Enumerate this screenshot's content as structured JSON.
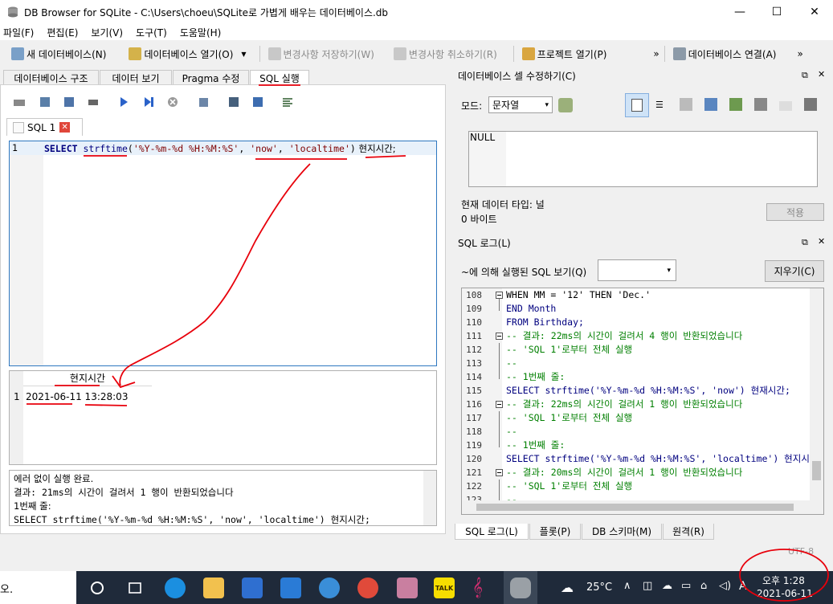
{
  "window": {
    "title": "DB Browser for SQLite - C:\\Users\\choeu\\SQLite로 가볍게 배우는 데이터베이스.db",
    "minimize": "—",
    "maximize": "☐",
    "close": "✕"
  },
  "menu": [
    "파일(F)",
    "편집(E)",
    "보기(V)",
    "도구(T)",
    "도움말(H)"
  ],
  "toolbar": {
    "new_db": "새 데이터베이스(N)",
    "open_db": "데이터베이스 열기(O)",
    "write_changes": "변경사항 저장하기(W)",
    "revert_changes": "변경사항 취소하기(R)",
    "open_project": "프로젝트 열기(P)",
    "attach_db": "데이터베이스 연결(A)",
    "overflow": "»"
  },
  "tabs": [
    "데이터베이스 구조",
    "데이터 보기",
    "Pragma 수정",
    "SQL 실행"
  ],
  "sql_tab": {
    "label": "SQL 1"
  },
  "editor": {
    "line_no": "1",
    "kw_select": "SELECT",
    "fn": "strftime",
    "p1": "(",
    "s1": "'%Y-%m-%d %H:%M:%S'",
    "c1": ", ",
    "s2": "'now'",
    "c2": ", ",
    "s3": "'localtime'",
    "p2": ")",
    "alias": " 현지시간;"
  },
  "result": {
    "header": "현지시간",
    "row_no": "1",
    "value": "2021-06-11 13:28:03"
  },
  "message": [
    "에러 없이 실행 완료.",
    "결과: 21ms의 시간이 걸려서 1 행이 반환되었습니다",
    "1번째 줄:",
    "SELECT strftime('%Y-%m-%d %H:%M:%S', 'now', 'localtime') 현지시간;"
  ],
  "cell_editor": {
    "title": "데이터베이스 셀 수정하기(C)",
    "mode_label": "모드:",
    "mode_value": "문자열",
    "null_text": "NULL",
    "type_label": "현재 데이터 타입: 널",
    "size_label": "0 바이트",
    "apply": "적용"
  },
  "sql_log": {
    "title": "SQL 로그(L)",
    "submitted_by": "~에 의해 실행된 SQL 보기(Q)",
    "clear": "지우기(C)",
    "lines": [
      {
        "n": "108",
        "t": "        WHEN MM = '12' THEN 'Dec.'"
      },
      {
        "n": "109",
        "t": "    END Month"
      },
      {
        "n": "110",
        "t": "FROM Birthday;"
      },
      {
        "n": "111",
        "t": "-- 결과: 22ms의 시간이 걸려서 4 행이 반환되었습니다"
      },
      {
        "n": "112",
        "t": "-- 'SQL 1'로부터 전체 실행"
      },
      {
        "n": "113",
        "t": "--"
      },
      {
        "n": "114",
        "t": "-- 1번째 줄:"
      },
      {
        "n": "115",
        "t": "SELECT strftime('%Y-%m-%d %H:%M:%S', 'now') 현재시간;"
      },
      {
        "n": "116",
        "t": "-- 결과: 22ms의 시간이 걸려서 1 행이 반환되었습니다"
      },
      {
        "n": "117",
        "t": "-- 'SQL 1'로부터 전체 실행"
      },
      {
        "n": "118",
        "t": "--"
      },
      {
        "n": "119",
        "t": "-- 1번째 줄:"
      },
      {
        "n": "120",
        "t": "SELECT strftime('%Y-%m-%d %H:%M:%S', 'localtime') 현지시"
      },
      {
        "n": "121",
        "t": "-- 결과: 20ms의 시간이 걸려서 1 행이 반환되었습니다"
      },
      {
        "n": "122",
        "t": "-- 'SQL 1'로부터 전체 실행"
      },
      {
        "n": "123",
        "t": "--"
      }
    ]
  },
  "bottom_tabs": [
    "SQL 로그(L)",
    "플롯(P)",
    "DB 스키마(M)",
    "원격(R)"
  ],
  "status": {
    "encoding": "UTF-8"
  },
  "taskbar": {
    "left_text": "오.",
    "weather": "25°C",
    "ime": "A",
    "time": "오후 1:28",
    "date": "2021-06-11"
  }
}
